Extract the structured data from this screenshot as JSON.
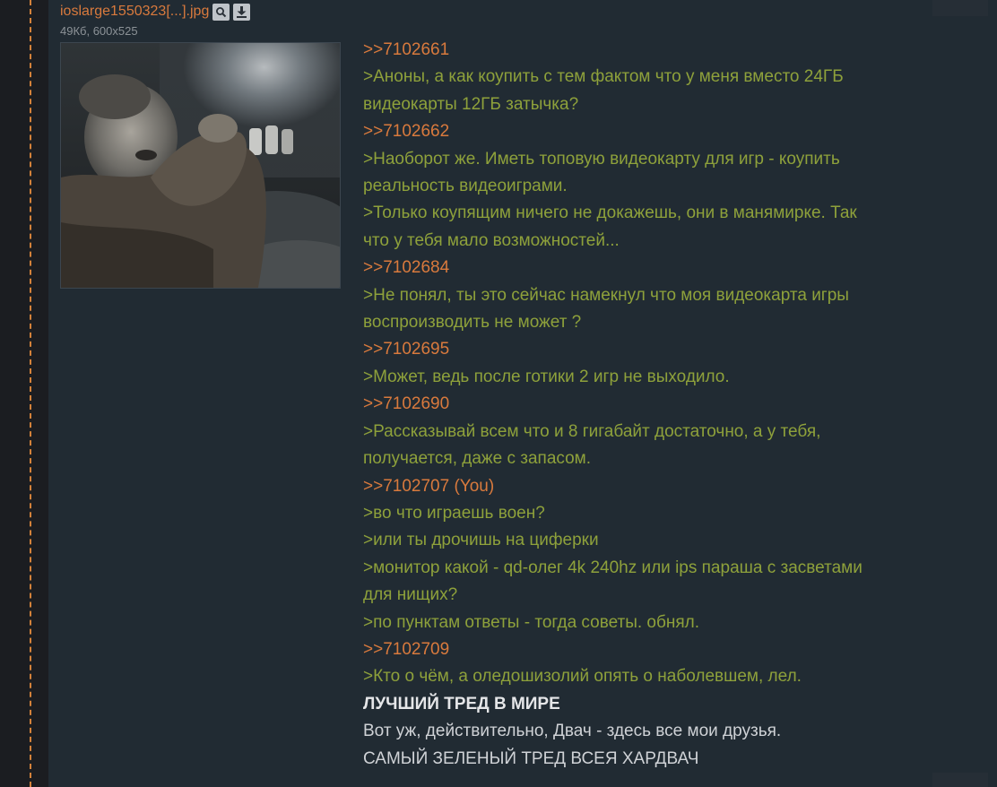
{
  "file": {
    "name": "ioslarge1550323[...].jpg",
    "meta": "49Кб, 600x525",
    "search_icon": "search-icon",
    "download_icon": "download-icon"
  },
  "lines": [
    {
      "kind": "reply-link",
      "text": ">>7102661"
    },
    {
      "kind": "quote",
      "text": ">Аноны, а как коупить с тем фактом что у меня вместо 24ГБ"
    },
    {
      "kind": "quote",
      "text": "видеокарты 12ГБ затычка?"
    },
    {
      "kind": "reply-link",
      "text": ">>7102662"
    },
    {
      "kind": "quote",
      "text": ">Наоборот же. Иметь топовую видеокарту для игр - коупить"
    },
    {
      "kind": "quote",
      "text": "реальность видеоиграми."
    },
    {
      "kind": "quote",
      "text": ">Только коупящим ничего не докажешь, они в манямирке. Так"
    },
    {
      "kind": "quote",
      "text": "что у тебя мало возможностей..."
    },
    {
      "kind": "reply-link",
      "text": ">>7102684"
    },
    {
      "kind": "quote",
      "text": ">Не понял, ты это сейчас намекнул что моя видеокарта игры"
    },
    {
      "kind": "quote",
      "text": "воспроизводить не может ?"
    },
    {
      "kind": "reply-link",
      "text": ">>7102695"
    },
    {
      "kind": "quote",
      "text": ">Может, ведь после готики 2 игр не выходило."
    },
    {
      "kind": "reply-link",
      "text": ">>7102690"
    },
    {
      "kind": "quote",
      "text": ">Рассказывай всем что и 8 гигабайт достаточно, а у тебя,"
    },
    {
      "kind": "quote",
      "text": "получается, даже с запасом."
    },
    {
      "kind": "reply-link",
      "text": ">>7102707 (You)"
    },
    {
      "kind": "quote",
      "text": ">во что играешь воен?"
    },
    {
      "kind": "quote",
      "text": ">или ты дрочишь на циферки"
    },
    {
      "kind": "quote",
      "text": ">монитор какой - qd-олег 4k 240hz или ips параша с засветами"
    },
    {
      "kind": "quote",
      "text": "для нищих?"
    },
    {
      "kind": "quote",
      "text": ">по пунктам ответы - тогда советы. обнял."
    },
    {
      "kind": "reply-link",
      "text": ">>7102709"
    },
    {
      "kind": "quote",
      "text": ">Кто о чём, а оледошизолий опять о наболевшем, лел."
    },
    {
      "kind": "bold",
      "text": "ЛУЧШИЙ ТРЕД В МИРЕ"
    },
    {
      "kind": "plain",
      "text": "Вот уж, действительно, Двач - здесь все мои друзья."
    },
    {
      "kind": "plain",
      "text": "САМЫЙ ЗЕЛЕНЫЙ ТРЕД ВСЕЯ ХАРДВАЧ"
    }
  ],
  "colors": {
    "reply_link": "#d97a3d",
    "quote": "#8ea13b",
    "plain": "#cfd2d6",
    "background": "#212b33"
  }
}
